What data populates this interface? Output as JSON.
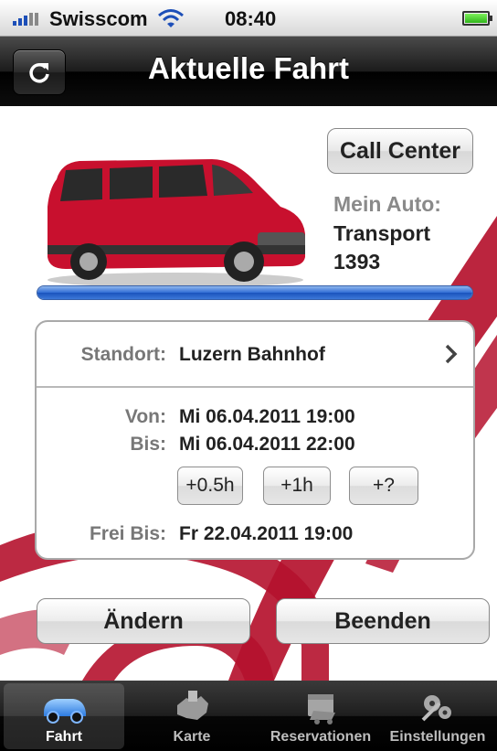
{
  "status_bar": {
    "carrier": "Swisscom",
    "time": "08:40"
  },
  "nav": {
    "title": "Aktuelle Fahrt",
    "refresh_icon": "refresh-icon"
  },
  "vehicle": {
    "call_center_label": "Call Center",
    "my_car_label": "Mein Auto:",
    "my_car_name": "Transport 1393",
    "progress": 1.0
  },
  "details": {
    "standort_label": "Standort:",
    "standort_value": "Luzern Bahnhof",
    "von_label": "Von:",
    "von_value": "Mi 06.04.2011 19:00",
    "bis_label": "Bis:",
    "bis_value": "Mi 06.04.2011 22:00",
    "extend_buttons": [
      "+0.5h",
      "+1h",
      "+?"
    ],
    "frei_bis_label": "Frei Bis:",
    "frei_bis_value": "Fr 22.04.2011 19:00"
  },
  "actions": {
    "change_label": "Ändern",
    "end_label": "Beenden"
  },
  "tabs": [
    {
      "label": "Fahrt",
      "icon": "car-icon",
      "active": true
    },
    {
      "label": "Karte",
      "icon": "map-icon",
      "active": false
    },
    {
      "label": "Reservationen",
      "icon": "calendar-icon",
      "active": false
    },
    {
      "label": "Einstellungen",
      "icon": "gears-icon",
      "active": false
    }
  ],
  "colors": {
    "accent_blue": "#2f6cd4",
    "brand_red": "#b5122e"
  }
}
